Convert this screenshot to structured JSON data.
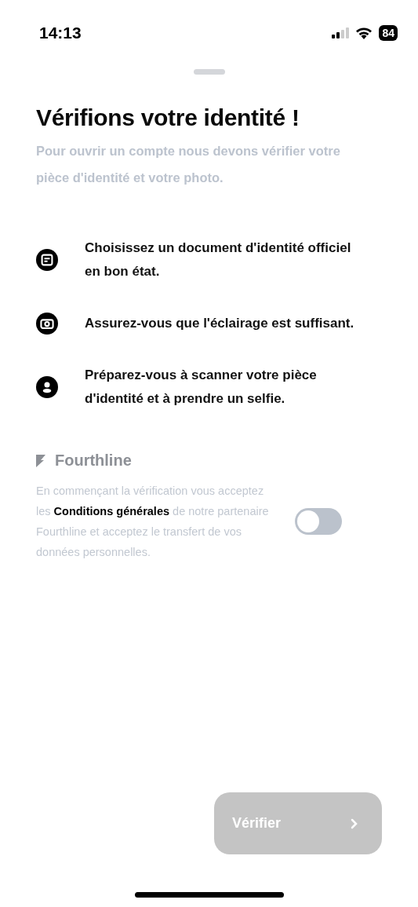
{
  "status_bar": {
    "time": "14:13",
    "battery": "84"
  },
  "title": "Vérifions votre identité !",
  "subtitle": "Pour ouvrir un compte nous devons vérifier votre pièce d'identité et votre photo.",
  "steps": [
    {
      "kind": "document",
      "text": "Choisissez un document d'identité officiel en bon état."
    },
    {
      "kind": "camera",
      "text": "Assurez-vous que l'éclairage est suffisant."
    },
    {
      "kind": "person",
      "text": "Préparez-vous à scanner votre pièce d'identité et à prendre un selfie."
    }
  ],
  "partner": {
    "name": "Fourthline"
  },
  "consent": {
    "before": "En commençant la vérification vous acceptez les",
    "link": "Conditions générales",
    "after": "de notre partenaire Fourthline et acceptez le transfert de vos données personnelles.",
    "on": false
  },
  "button": {
    "label": "Vérifier",
    "disabled": true
  }
}
